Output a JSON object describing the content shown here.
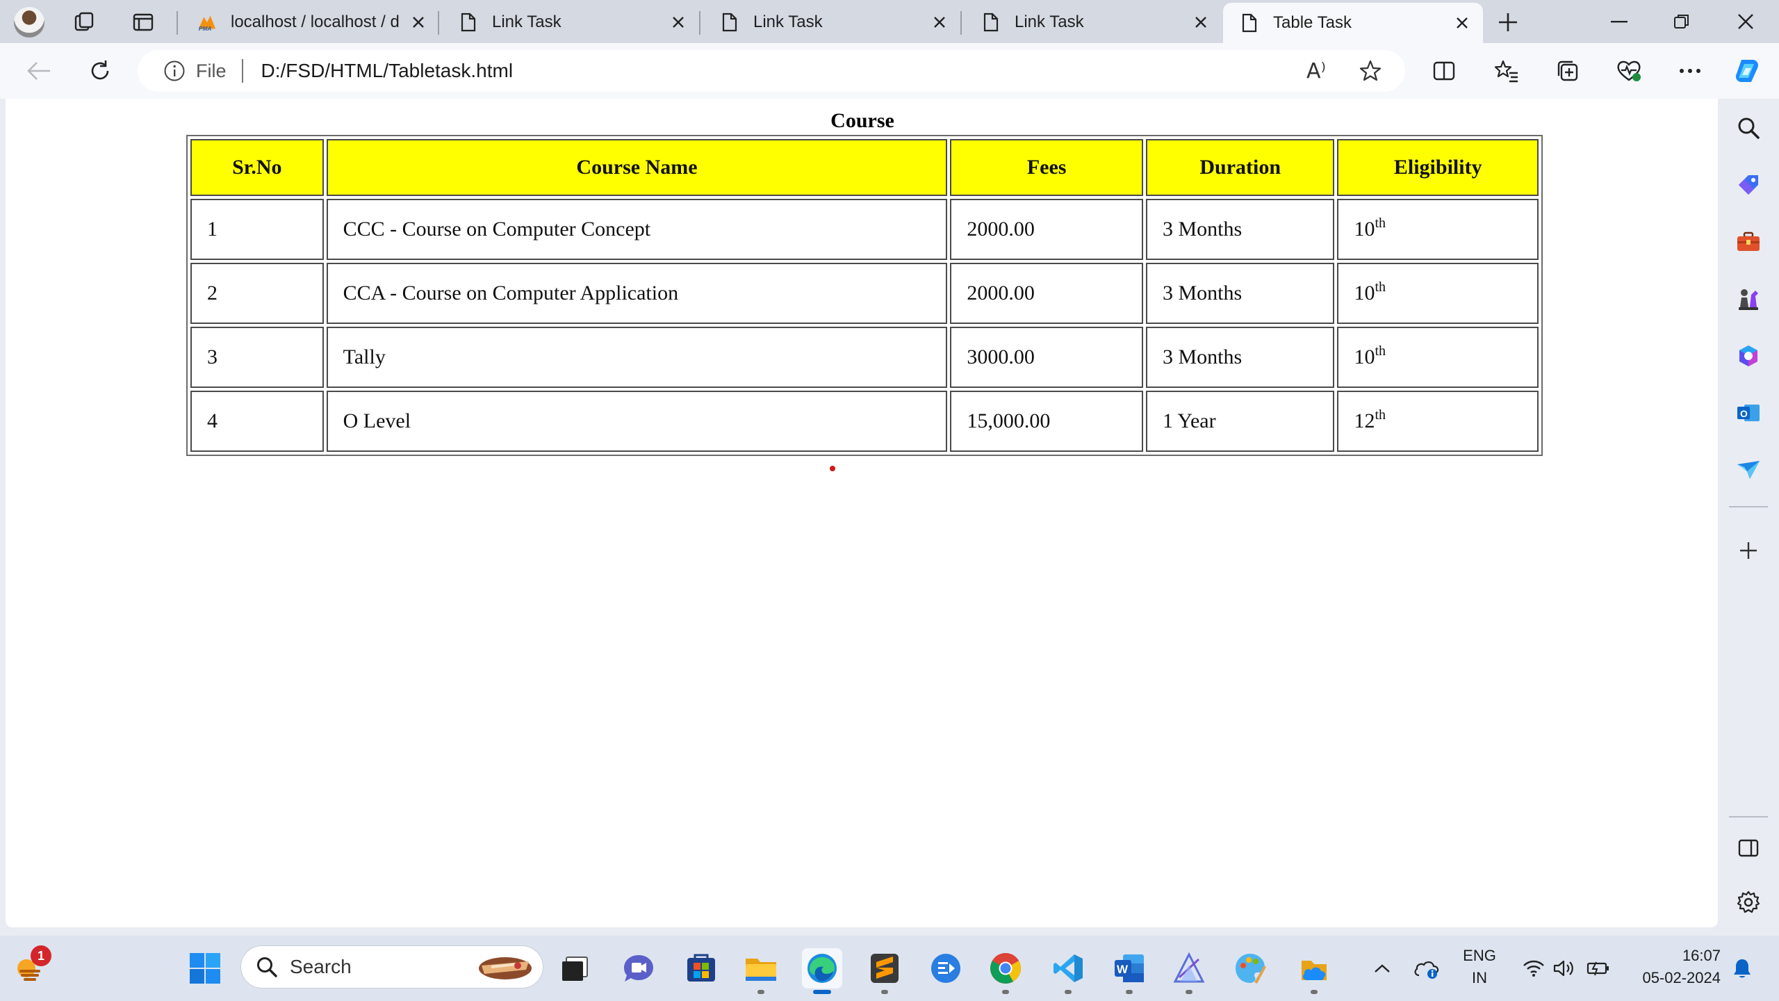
{
  "browser": {
    "tabs": [
      {
        "label": "localhost / localhost / d",
        "icon": "phpmyadmin-icon"
      },
      {
        "label": "Link Task",
        "icon": "page-icon"
      },
      {
        "label": "Link Task",
        "icon": "page-icon"
      },
      {
        "label": "Link Task",
        "icon": "page-icon"
      },
      {
        "label": "Table Task",
        "icon": "page-icon",
        "active": true
      }
    ],
    "address": {
      "scheme_label": "File",
      "url": "D:/FSD/HTML/Tabletask.html"
    },
    "read_aloud_glyph": "A⁾"
  },
  "page": {
    "table": {
      "caption": "Course",
      "headers": [
        "Sr.No",
        "Course Name",
        "Fees",
        "Duration",
        "Eligibility"
      ],
      "rows": [
        {
          "sr": "1",
          "name": "CCC - Course on Computer Concept",
          "fees": "2000.00",
          "duration": "3 Months",
          "elig_num": "10",
          "elig_sup": "th"
        },
        {
          "sr": "2",
          "name": "CCA - Course on Computer Application",
          "fees": "2000.00",
          "duration": "3 Months",
          "elig_num": "10",
          "elig_sup": "th"
        },
        {
          "sr": "3",
          "name": "Tally",
          "fees": "3000.00",
          "duration": "3 Months",
          "elig_num": "10",
          "elig_sup": "th"
        },
        {
          "sr": "4",
          "name": "O Level",
          "fees": "15,000.00",
          "duration": "1 Year",
          "elig_num": "12",
          "elig_sup": "th"
        }
      ]
    }
  },
  "taskbar": {
    "search_label": "Search",
    "weather_badge": "1",
    "language": {
      "line1": "ENG",
      "line2": "IN"
    },
    "clock": {
      "time": "16:07",
      "date": "05-02-2024"
    }
  },
  "colors": {
    "header_fill": "#ffff00",
    "tab_strip": "#d4d9e2",
    "active_tab": "#f7f8fb",
    "accent": "#0a64c8"
  }
}
